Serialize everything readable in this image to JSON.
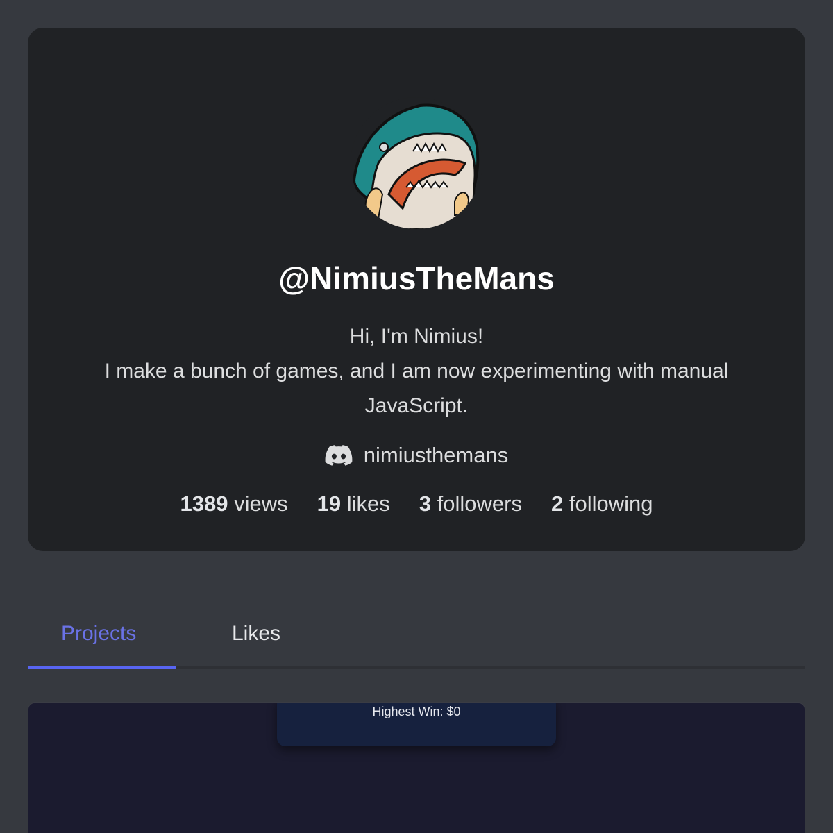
{
  "profile": {
    "username": "@NimiusTheMans",
    "bio_lines": [
      "Hi, I'm Nimius!",
      "I make a bunch of games, and I am now experimenting with manual",
      "JavaScript."
    ],
    "discord": {
      "icon": "discord-icon",
      "handle": "nimiusthemans"
    },
    "stats": {
      "views": {
        "count": "1389",
        "label": "views"
      },
      "likes": {
        "count": "19",
        "label": "likes"
      },
      "followers": {
        "count": "3",
        "label": "followers"
      },
      "following": {
        "count": "2",
        "label": "following"
      }
    },
    "avatar_icon": "shark-avatar"
  },
  "tabs": [
    {
      "label": "Projects",
      "active": true
    },
    {
      "label": "Likes",
      "active": false
    }
  ],
  "project": {
    "highest_win": "Highest Win: $0"
  },
  "colors": {
    "background": "#36393f",
    "card": "#202225",
    "accent": "#5865f2",
    "active_tab_text": "#6a72e6",
    "project_bg": "#1b1b2f",
    "project_panel": "#16213e"
  }
}
